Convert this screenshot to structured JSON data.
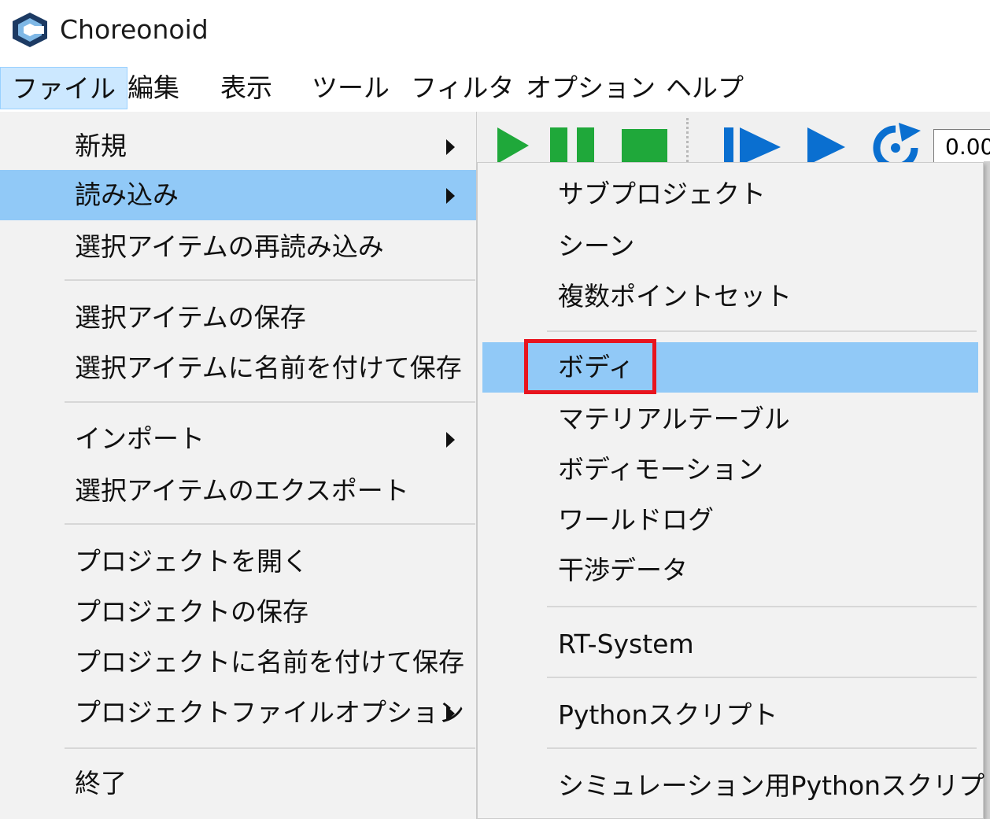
{
  "window": {
    "title": "Choreonoid",
    "icon": "choreonoid-logo-icon"
  },
  "menubar": {
    "items": [
      "ファイル",
      "編集",
      "表示",
      "ツール",
      "フィルタ",
      "オプション",
      "ヘルプ"
    ],
    "active_index": 0
  },
  "toolbar": {
    "icons": [
      "play-icon",
      "pause-icon",
      "stop-icon",
      "step-play-icon",
      "play-icon",
      "refresh-icon"
    ],
    "time_value": "0.00"
  },
  "file_menu": {
    "items": [
      {
        "label": "新規",
        "submenu": true
      },
      {
        "label": "読み込み",
        "submenu": true,
        "highlighted": true
      },
      {
        "label": "選択アイテムの再読み込み",
        "submenu": false
      },
      {
        "label": "選択アイテムの保存",
        "submenu": false
      },
      {
        "label": "選択アイテムに名前を付けて保存",
        "submenu": false
      },
      {
        "label": "インポート",
        "submenu": true
      },
      {
        "label": "選択アイテムのエクスポート",
        "submenu": false
      },
      {
        "label": "プロジェクトを開く",
        "submenu": false
      },
      {
        "label": "プロジェクトの保存",
        "submenu": false
      },
      {
        "label": "プロジェクトに名前を付けて保存",
        "submenu": false
      },
      {
        "label": "プロジェクトファイルオプション",
        "submenu": true
      },
      {
        "label": "終了",
        "submenu": false
      }
    ]
  },
  "load_submenu": {
    "items": [
      {
        "label": "サブプロジェクト"
      },
      {
        "label": "シーン"
      },
      {
        "label": "複数ポイントセット"
      },
      {
        "label": "ボディ",
        "highlighted": true,
        "annotated": true
      },
      {
        "label": "マテリアルテーブル"
      },
      {
        "label": "ボディモーション"
      },
      {
        "label": "ワールドログ"
      },
      {
        "label": "干渉データ"
      },
      {
        "label": "RT-System"
      },
      {
        "label": "Pythonスクリプト"
      },
      {
        "label": "シミュレーション用Pythonスクリプト"
      }
    ]
  },
  "colors": {
    "menu_background": "#f2f2f2",
    "hover_background": "#91c9f7",
    "annotation_border": "#e8141e",
    "toolbar_green": "#1fa83a",
    "toolbar_blue": "#0a6fd0"
  }
}
